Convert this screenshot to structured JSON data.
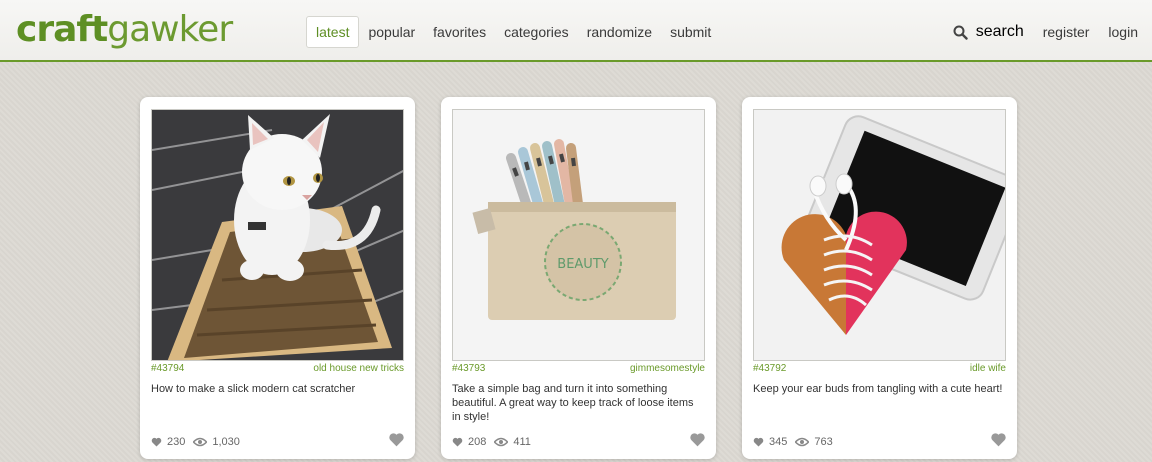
{
  "site": {
    "logo_bold": "craft",
    "logo_light": "gawker"
  },
  "nav": {
    "items": [
      {
        "label": "latest",
        "active": true
      },
      {
        "label": "popular"
      },
      {
        "label": "favorites"
      },
      {
        "label": "categories"
      },
      {
        "label": "randomize"
      },
      {
        "label": "submit"
      }
    ],
    "search_label": "search",
    "register_label": "register",
    "login_label": "login"
  },
  "colors": {
    "brand_green": "#5e8f24",
    "background": "#dcd9d3"
  },
  "cards": [
    {
      "id": "#43794",
      "source": "old house new tricks",
      "description": "How to make a slick modern cat scratcher",
      "likes": "230",
      "views": "1,030",
      "image": "white cat sitting on cardboard scratcher"
    },
    {
      "id": "#43793",
      "source": "gimmesomestyle",
      "description": "Take a simple bag and turn it into something beautiful. A great way to keep track of loose items in style!",
      "likes": "208",
      "views": "411",
      "bag_text": "BEAUTY",
      "image": "linen zipper pouch with markers"
    },
    {
      "id": "#43792",
      "source": "idle wife",
      "description": "Keep your ear buds from tangling with a cute heart!",
      "likes": "345",
      "views": "763",
      "image": "phone with earbuds wrapped around heart"
    }
  ]
}
